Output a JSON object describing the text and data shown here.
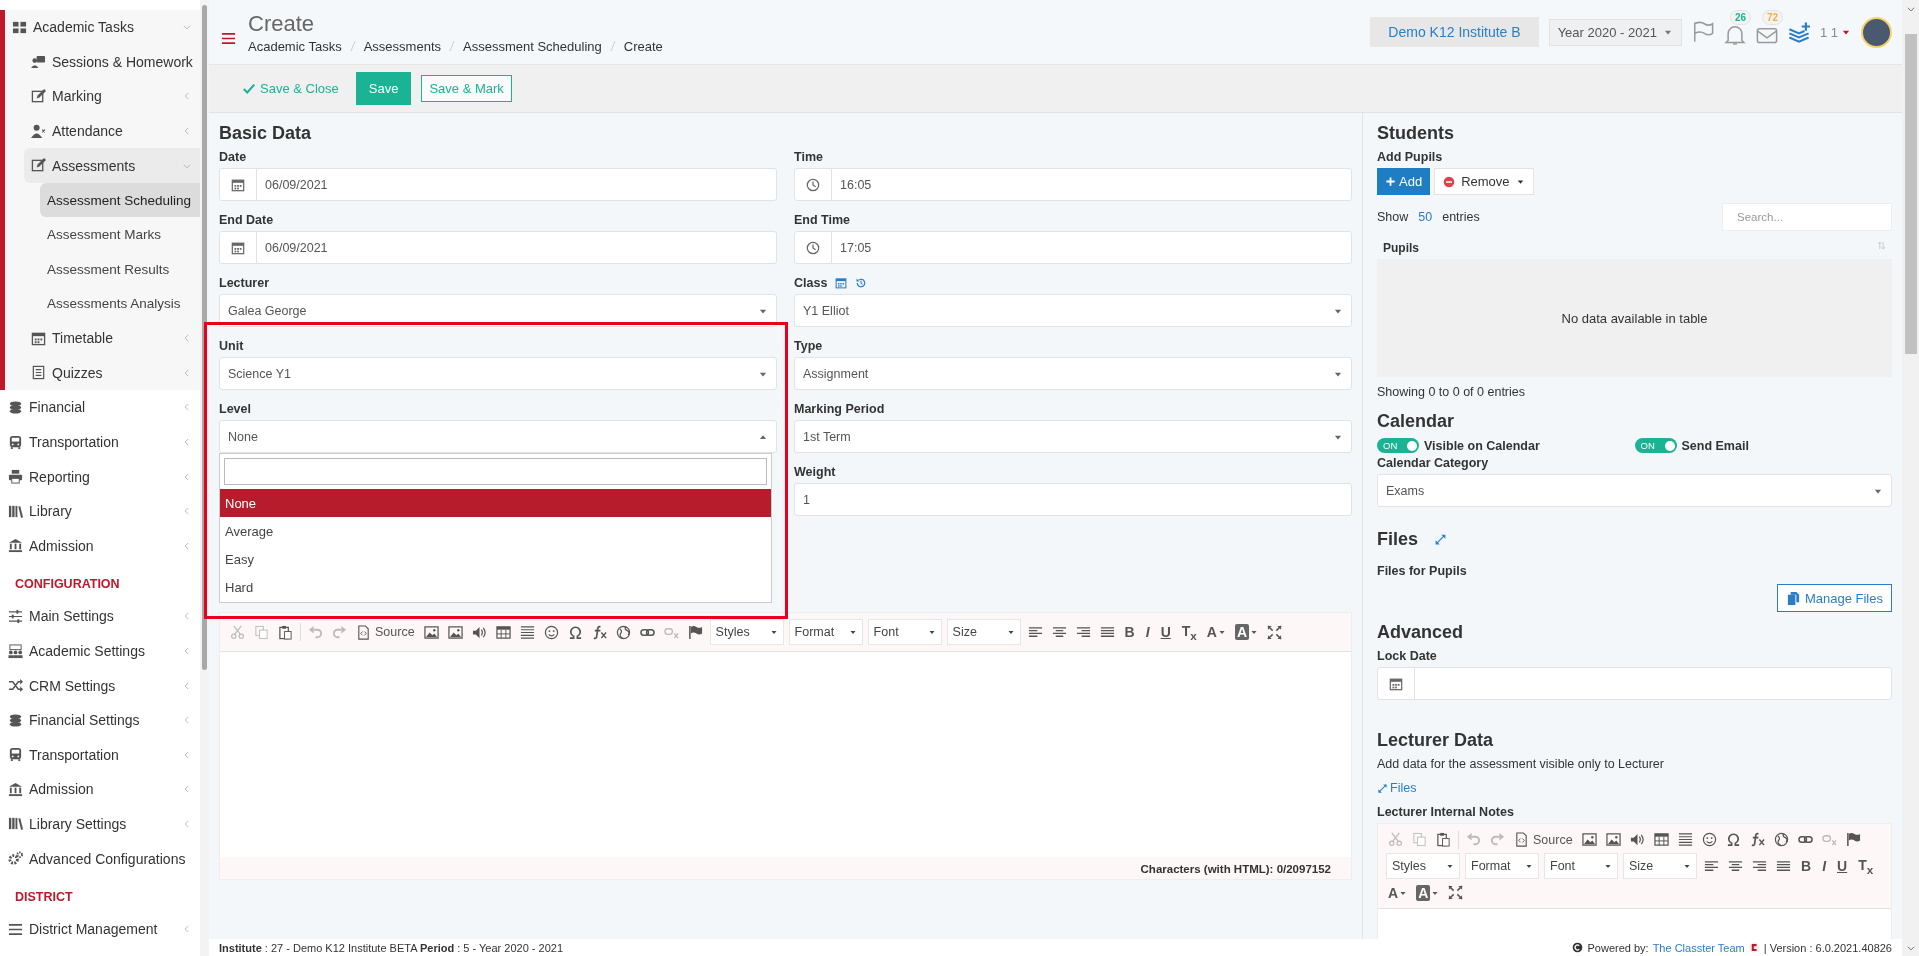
{
  "sidebar": {
    "sections": [
      {
        "items": [
          {
            "label": "Academic Tasks",
            "selected": false,
            "expanded": true,
            "children": [
              {
                "label": "Sessions & Homework",
                "selected": false,
                "expanded": false
              },
              {
                "label": "Marking",
                "selected": false,
                "expanded": false
              },
              {
                "label": "Attendance",
                "selected": false,
                "expanded": false
              },
              {
                "label": "Assessments",
                "selected": false,
                "expanded": true,
                "children": [
                  {
                    "label": "Assessment Scheduling",
                    "selected": true
                  },
                  {
                    "label": "Assessment Marks",
                    "selected": false
                  },
                  {
                    "label": "Assessment Results",
                    "selected": false
                  },
                  {
                    "label": "Assessments Analysis",
                    "selected": false
                  }
                ]
              },
              {
                "label": "Timetable",
                "selected": false,
                "expanded": false
              },
              {
                "label": "Quizzes",
                "selected": false,
                "expanded": false
              }
            ]
          },
          {
            "label": "Financial",
            "selected": false,
            "expanded": false
          },
          {
            "label": "Transportation",
            "selected": false,
            "expanded": false
          },
          {
            "label": "Reporting",
            "selected": false,
            "expanded": false
          },
          {
            "label": "Library",
            "selected": false,
            "expanded": false
          },
          {
            "label": "Admission",
            "selected": false,
            "expanded": false
          }
        ]
      },
      {
        "heading": "CONFIGURATION",
        "items": [
          {
            "label": "Main Settings",
            "selected": false,
            "expanded": false
          },
          {
            "label": "Academic Settings",
            "selected": false,
            "expanded": false
          },
          {
            "label": "CRM Settings",
            "selected": false,
            "expanded": false
          },
          {
            "label": "Financial Settings",
            "selected": false,
            "expanded": false
          },
          {
            "label": "Transportation",
            "selected": false,
            "expanded": false
          },
          {
            "label": "Admission",
            "selected": false,
            "expanded": false
          },
          {
            "label": "Library Settings",
            "selected": false,
            "expanded": false
          },
          {
            "label": "Advanced Configurations",
            "selected": false
          }
        ]
      },
      {
        "heading": "DISTRICT",
        "items": [
          {
            "label": "District Management",
            "selected": false,
            "expanded": false
          }
        ]
      }
    ]
  },
  "header": {
    "title": "Create",
    "breadcrumbs": [
      "Academic Tasks",
      "Assessments",
      "Assessment Scheduling",
      "Create"
    ],
    "institute": "Demo K12 Institute B",
    "year": "Year 2020 - 2021",
    "notifications": [
      {
        "kind": "bell",
        "count": "26",
        "color": "#1ab394"
      },
      {
        "kind": "mail",
        "count": "72",
        "color": "#f0ad4e"
      }
    ],
    "user": "1 1"
  },
  "actions": [
    {
      "label": "Save & Close",
      "kind": "link"
    },
    {
      "label": "Save",
      "kind": "primary"
    },
    {
      "label": "Save & Mark",
      "kind": "outline"
    }
  ],
  "basic_data": {
    "title": "Basic Data",
    "rows": [
      {
        "left": {
          "label": "Date",
          "kind": "date",
          "value": "06/09/2021"
        },
        "right": {
          "label": "Time",
          "kind": "time",
          "value": "16:05"
        }
      },
      {
        "left": {
          "label": "End Date",
          "kind": "date",
          "value": "06/09/2021"
        },
        "right": {
          "label": "End Time",
          "kind": "time",
          "value": "17:05"
        }
      },
      {
        "left": {
          "label": "Lecturer",
          "kind": "select",
          "value": "Galea George"
        },
        "right": {
          "label": "Class",
          "kind": "select",
          "value": "Y1 Elliot",
          "label_tools": true
        }
      },
      {
        "left": {
          "label": "Unit",
          "kind": "select",
          "value": "Science Y1",
          "highlighted": true
        },
        "right": {
          "label": "Type",
          "kind": "select",
          "value": "Assignment"
        }
      },
      {
        "left": {
          "label": "Level",
          "kind": "select",
          "value": "None",
          "expanded": true,
          "options": [
            {
              "label": "None",
              "selected": true
            },
            {
              "label": "Average",
              "selected": false
            },
            {
              "label": "Easy",
              "selected": false
            },
            {
              "label": "Hard",
              "selected": false
            }
          ]
        },
        "right": {
          "label": "Marking Period",
          "kind": "select",
          "value": "1st Term"
        }
      },
      {
        "right": {
          "label": "Weight",
          "kind": "text",
          "value": "1"
        }
      }
    ]
  },
  "description_editor": {
    "source": "Source",
    "combos": [
      "Styles",
      "Format",
      "Font",
      "Size"
    ],
    "text_buttons": [
      "B",
      "I",
      "U",
      "T$_{x}$"
    ],
    "color_buttons": [
      "A",
      "A"
    ],
    "counter": "Characters (with HTML): 0/2097152"
  },
  "students": {
    "title": "Students",
    "add_label": "Add Pupils",
    "add_button": "Add",
    "remove_button": "Remove",
    "show": "Show",
    "page_size": "50",
    "entries": "entries",
    "search_placeholder": "Search...",
    "columns": [
      "Pupils"
    ],
    "empty": "No data available in table",
    "info": "Showing 0 to 0 of 0 entries"
  },
  "calendar": {
    "title": "Calendar",
    "toggles": [
      {
        "label": "Visible on Calendar",
        "on": true,
        "state_text": "ON"
      },
      {
        "label": "Send Email",
        "on": true,
        "state_text": "ON"
      }
    ],
    "category_label": "Calendar Category",
    "category": "Exams"
  },
  "files": {
    "title": "Files",
    "label": "Files for Pupils",
    "button": "Manage Files"
  },
  "advanced": {
    "title": "Advanced",
    "lock_label": "Lock Date"
  },
  "lecturer": {
    "title": "Lecturer Data",
    "description": "Add data for the assessment visible only to Lecturer",
    "files_link": "Files",
    "notes_label": "Lecturer Internal Notes",
    "editor": {
      "source": "Source",
      "combos": [
        "Styles",
        "Format",
        "Font",
        "Size"
      ],
      "text_buttons": [
        "B",
        "I",
        "U",
        "T$_{x}$"
      ],
      "color_buttons": [
        "A",
        "A"
      ]
    }
  },
  "footer": {
    "info": "**Institute** : 27 - Demo K12 Institute BETA **Period** : 5 - Year 2020 - 2021",
    "powered": "Powered by:",
    "team": "The Classter Team",
    "version": "| Version : 6.0.2021.40826"
  }
}
